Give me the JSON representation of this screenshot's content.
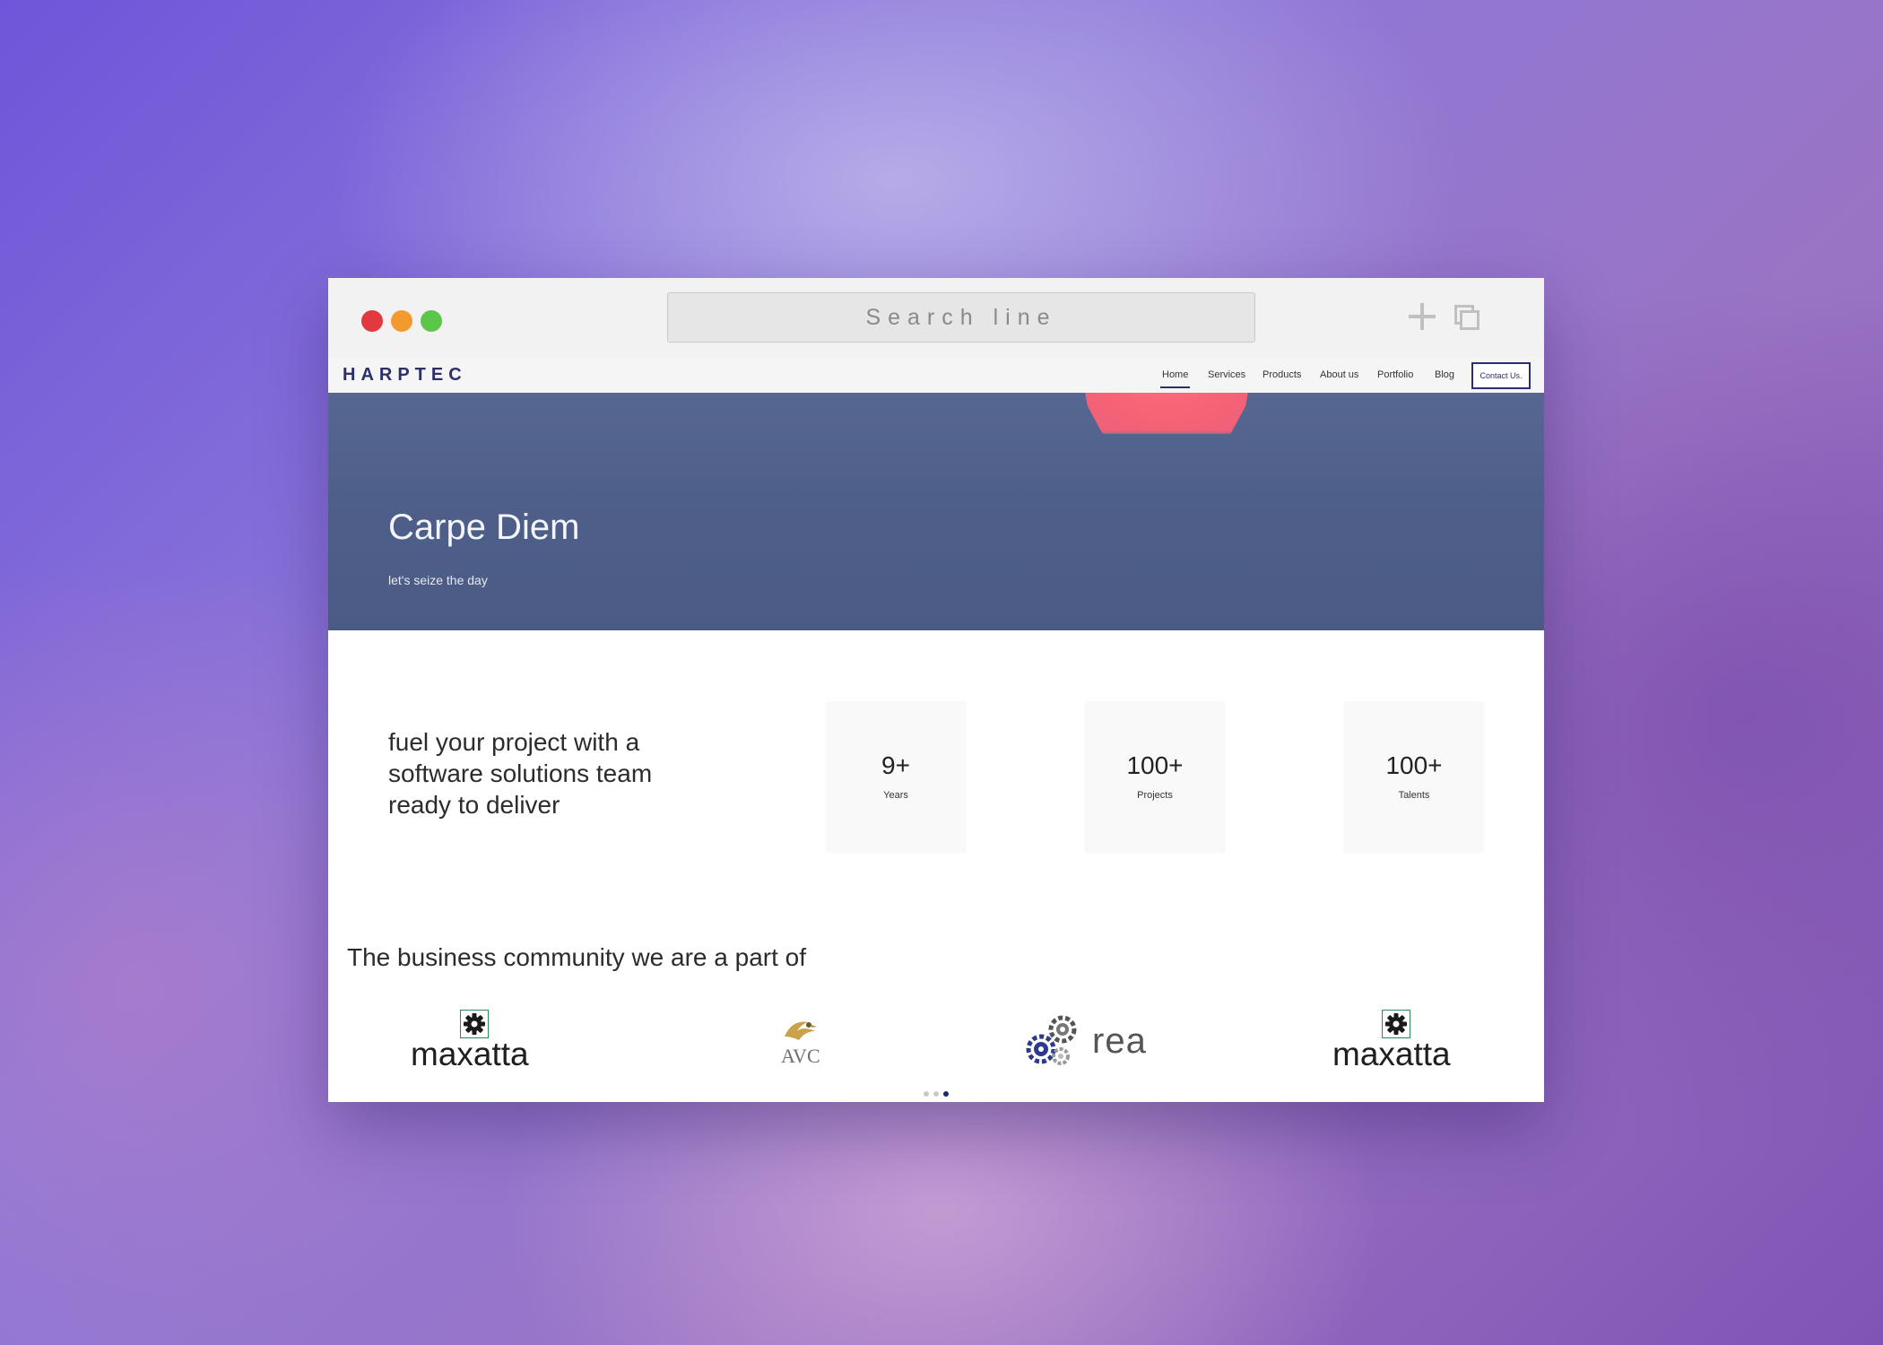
{
  "browser": {
    "search_placeholder": "Search line"
  },
  "site": {
    "logo": "HARPTEC",
    "nav": [
      {
        "label": "Home",
        "active": true
      },
      {
        "label": "Services"
      },
      {
        "label": "Products"
      },
      {
        "label": "About us"
      },
      {
        "label": "Portfolio"
      },
      {
        "label": "Blog"
      }
    ],
    "contact_label": "Contact Us."
  },
  "hero": {
    "title": "Carpe Diem",
    "subtitle": "let's seize the day"
  },
  "intro": {
    "text": "fuel your project with a software solutions team ready to deliver"
  },
  "stats": [
    {
      "value": "9+",
      "label": "Years"
    },
    {
      "value": "100+",
      "label": "Projects"
    },
    {
      "value": "100+",
      "label": "Talents"
    }
  ],
  "community": {
    "title": "The business community we are a part of",
    "partners": [
      {
        "name": "maxatta"
      },
      {
        "name": "AVC"
      },
      {
        "name": "rea"
      },
      {
        "name": "maxatta"
      }
    ]
  },
  "carousel": {
    "active_index": 2,
    "count": 3
  },
  "colors": {
    "brand": "#2b2f6b",
    "hero_overlay": "#4e5f89",
    "sun": "#f76276"
  }
}
